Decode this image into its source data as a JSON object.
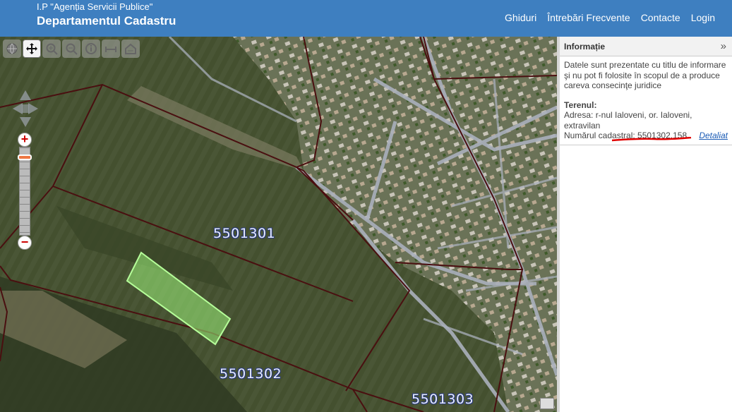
{
  "header": {
    "org": "I.P \"Agenția Servicii Publice\"",
    "department": "Departamentul Cadastru",
    "nav": [
      "Ghiduri",
      "Întrebări Frecvente",
      "Contacte",
      "Login"
    ]
  },
  "map": {
    "toolbar_icons": [
      "globe-icon",
      "pan-icon",
      "zoom-in-icon",
      "zoom-out-icon",
      "info-icon",
      "measure-icon",
      "home-icon"
    ],
    "zoom_in": "+",
    "zoom_out": "−",
    "parcel_labels": [
      "5501301",
      "5501302",
      "5501303"
    ]
  },
  "panel": {
    "title": "Informație",
    "disclaimer": "Datele sunt prezentate cu titlu de informare şi nu pot fi folosite în scopul de a produce careva consecinţe juridice",
    "section": "Terenul:",
    "address": "Adresa: r-nul Ialoveni, or. Ialoveni, extravilan",
    "cadastral": "Numărul cadastral: 5501302.158",
    "detail_link": "Detaliat"
  },
  "colors": {
    "header": "#3e7fc0",
    "parcel_border": "#4a0f10",
    "selected_parcel": "#9cf27a",
    "road": "#aab0bc",
    "annotation": "#e00000"
  }
}
